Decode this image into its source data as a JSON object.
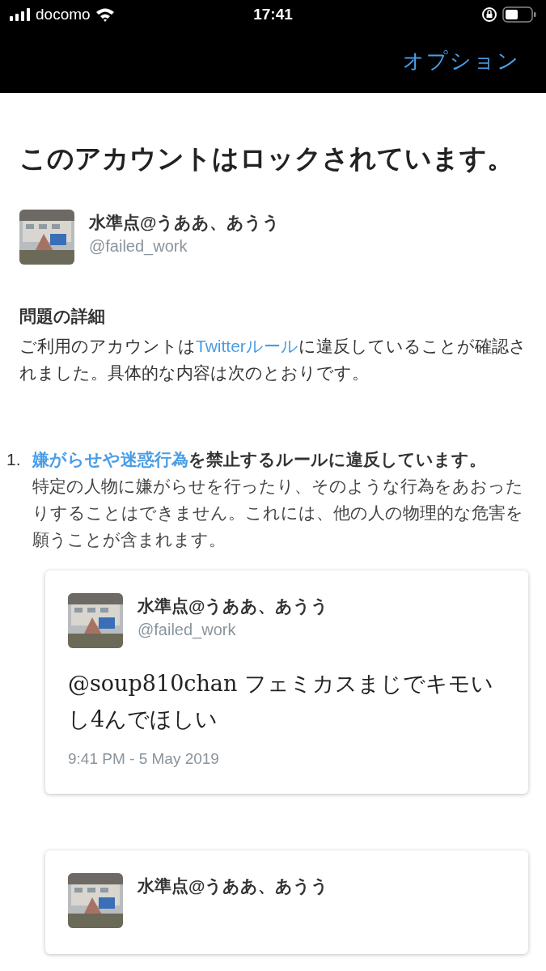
{
  "status_bar": {
    "carrier": "docomo",
    "time": "17:41"
  },
  "nav": {
    "options_label": "オプション"
  },
  "title": "このアカウントはロックされています。",
  "account": {
    "name": "水準点@うああ、あうう",
    "handle": "@failed_work"
  },
  "details": {
    "heading": "問題の詳細",
    "text_before": "ご利用のアカウントは",
    "link": "Twitterルール",
    "text_after": "に違反していることが確認されました。具体的な内容は次のとおりです。"
  },
  "violations": [
    {
      "number": "1.",
      "link": "嫌がらせや迷惑行為",
      "title_rest": "を禁止するルールに違反しています。",
      "description": "特定の人物に嫌がらせを行ったり、そのような行為をあおったりすることはできません。これには、他の人の物理的な危害を願うことが含まれます。"
    }
  ],
  "tweets": [
    {
      "name": "水準点@うああ、あうう",
      "handle": "@failed_work",
      "text": "@soup810chan フェミカスまじでキモいし4んでほしい",
      "date": "9:41 PM - 5 May 2019"
    },
    {
      "name": "水準点@うああ、あうう"
    }
  ]
}
